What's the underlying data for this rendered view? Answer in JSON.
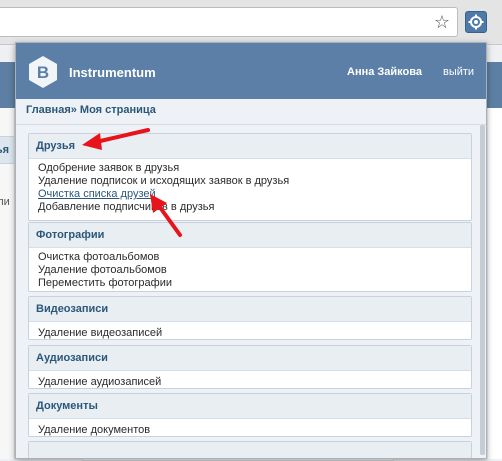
{
  "browser": {
    "star_icon": "star-icon",
    "extension_icon": "gear-icon"
  },
  "background": {
    "tab_label": "Друзья",
    "text_fragment": "Пользователи"
  },
  "popup": {
    "app_title": "Instrumentum",
    "user_name": "Анна Зайкова",
    "logout": "выйти",
    "breadcrumb": "Главная» Моя страница",
    "accent_color": "#5b7fa6",
    "sections": [
      {
        "title": "Друзья",
        "items": [
          "Одобрение заявок в друзья",
          "Удаление подписок и исходящих заявок в друзья",
          "Очистка списка друзей",
          "Добавление подписчиков в друзья"
        ]
      },
      {
        "title": "Фотографии",
        "items": [
          "Очистка фотоальбомов",
          "Удаление фотоальбомов",
          "Переместить фотографии"
        ]
      },
      {
        "title": "Видеозаписи",
        "items": [
          "Удаление видеозаписей"
        ]
      },
      {
        "title": "Аудиозаписи",
        "items": [
          "Удаление аудиозаписей"
        ]
      },
      {
        "title": "Документы",
        "items": [
          "Удаление документов"
        ]
      }
    ]
  },
  "annotation_color": "#e8141c"
}
